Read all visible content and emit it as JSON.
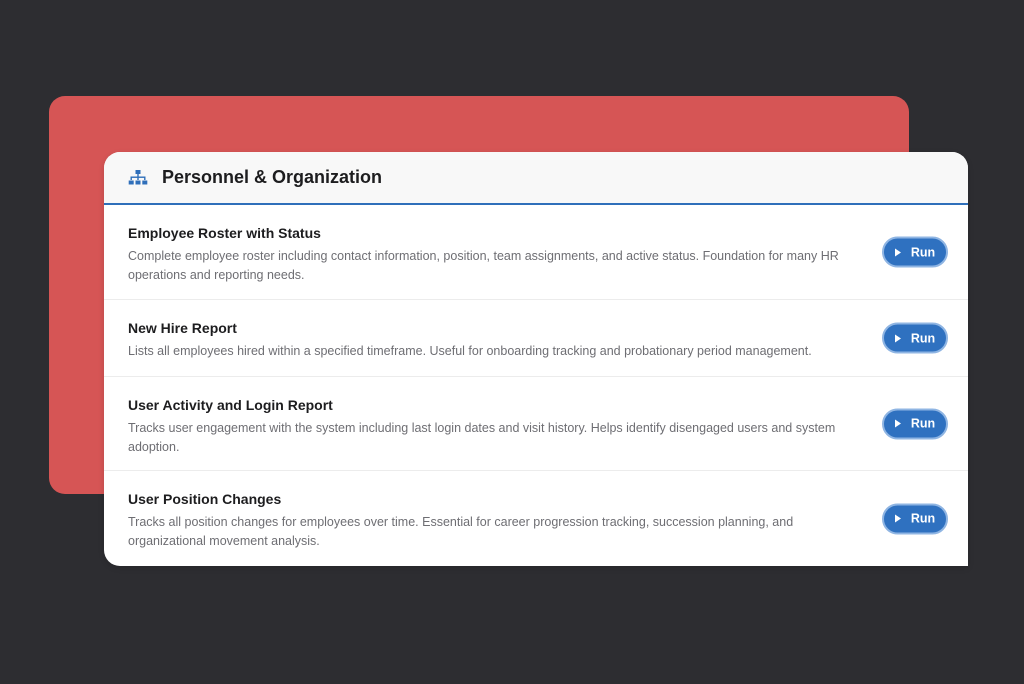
{
  "panel": {
    "title": "Personnel & Organization",
    "icon": "org-chart-icon",
    "accent_color": "#2f6fba"
  },
  "background": {
    "page_color": "#2d2d31",
    "back_card_color": "#d65555"
  },
  "reports": [
    {
      "title": "Employee Roster with Status",
      "description": "Complete employee roster including contact information, position, team assignments, and active status. Foundation for many HR operations and reporting needs.",
      "button_label": "Run"
    },
    {
      "title": "New Hire Report",
      "description": "Lists all employees hired within a specified timeframe. Useful for onboarding tracking and probationary period management.",
      "button_label": "Run"
    },
    {
      "title": "User Activity and Login Report",
      "description": "Tracks user engagement with the system including last login dates and visit history. Helps identify disengaged users and system adoption.",
      "button_label": "Run"
    },
    {
      "title": "User Position Changes",
      "description": "Tracks all position changes for employees over time. Essential for career progression tracking, succession planning, and organizational movement analysis.",
      "button_label": "Run"
    }
  ],
  "button": {
    "color": "#2f71c0",
    "icon": "play-icon"
  }
}
